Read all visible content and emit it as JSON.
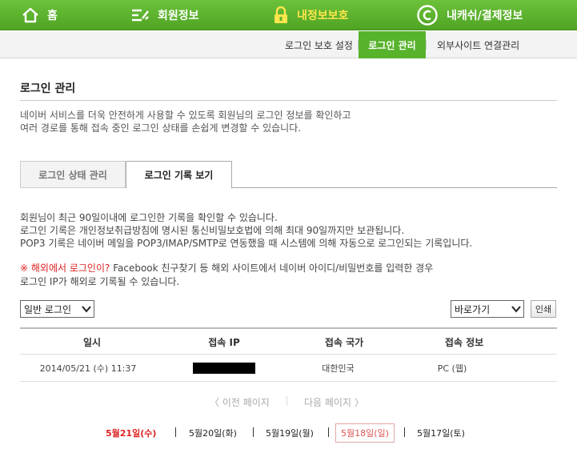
{
  "topnav": {
    "home": "홈",
    "member_info": "회원정보",
    "my_security": "내정보보호",
    "cash_payment": "내캐쉬/결제정보"
  },
  "subnav": {
    "items": [
      "로그인 보호 설정",
      "로그인 관리",
      "외부사이트 연결관리"
    ],
    "active": "로그인 관리"
  },
  "page": {
    "title": "로그인 관리",
    "desc_line1": "네이버 서비스를 더욱 안전하게 사용할 수 있도록 회원님의 로그인 정보를 확인하고",
    "desc_line2": "여러 경로를 통해 접속 중인 로그인 상태를 손쉽게 변경할 수 있습니다."
  },
  "tabs": {
    "status": "로그인 상태 관리",
    "history": "로그인 기록 보기"
  },
  "info": {
    "line1": "회원님이 최근 90일이내에 로그인한 기록을 확인할 수 있습니다.",
    "line2": "로그인 기록은 개인정보취급방침에 명시된 통신비밀보호법에 의해 최대 90일까지만 보관됩니다.",
    "line3": "POP3 기록은 네이버 메일을 POP3/IMAP/SMTP로 연동했을 때 시스템에 의해 자동으로 로그인되는 기록입니다.",
    "warn_mark": "※ 해외에서 로그인이?",
    "warn_text": " Facebook 친구찾기 등 해외 사이트에서 네이버 아이디/비밀번호를 입력한 경우",
    "warn_line2": "로그인 IP가 해외로 기록될 수 있습니다."
  },
  "controls": {
    "login_type": "일반 로그인",
    "goto": "바로가기",
    "print": "인쇄"
  },
  "table": {
    "headers": [
      "일시",
      "접속 IP",
      "접속 국가",
      "접속 정보"
    ],
    "rows": [
      {
        "datetime": "2014/05/21 (수) 11:37",
        "ip": "",
        "country": "대한민국",
        "client": "PC (웹)"
      }
    ]
  },
  "pager": {
    "prev": "〈 이전 페이지",
    "next": "다음 페이지 〉"
  },
  "days": [
    "5월21일(수)",
    "5월20일(화)",
    "5월19일(월)",
    "5월18일(일)",
    "5월17일(토)"
  ]
}
